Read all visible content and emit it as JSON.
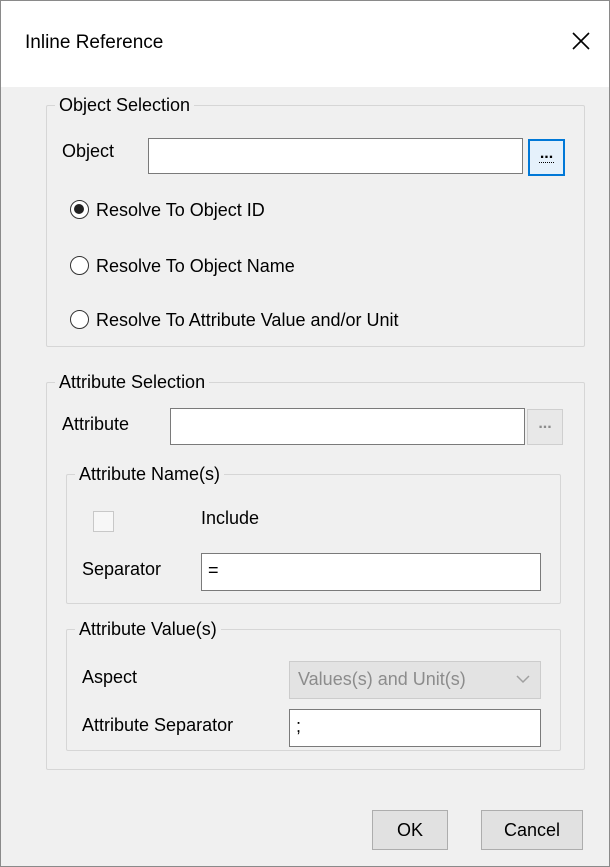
{
  "window": {
    "title": "Inline Reference"
  },
  "object_selection": {
    "legend": "Object Selection",
    "object_label": "Object",
    "object_value": "",
    "browse_label": "...",
    "radio_options": [
      {
        "label": "Resolve To Object ID",
        "checked": true
      },
      {
        "label": "Resolve To Object Name",
        "checked": false
      },
      {
        "label": "Resolve To Attribute Value and/or Unit",
        "checked": false
      }
    ]
  },
  "attribute_selection": {
    "legend": "Attribute Selection",
    "attribute_label": "Attribute",
    "attribute_value": "",
    "browse_label": "...",
    "names": {
      "legend": "Attribute Name(s)",
      "include_label": "Include",
      "include_checked": false,
      "separator_label": "Separator",
      "separator_value": "="
    },
    "values": {
      "legend": "Attribute Value(s)",
      "aspect_label": "Aspect",
      "aspect_selected": "Values(s) and Unit(s)",
      "attribute_separator_label": "Attribute Separator",
      "attribute_separator_value": ";"
    }
  },
  "buttons": {
    "ok": "OK",
    "cancel": "Cancel"
  },
  "colors": {
    "focus_border": "#0078d7",
    "disabled_text": "#8c8c8c"
  }
}
